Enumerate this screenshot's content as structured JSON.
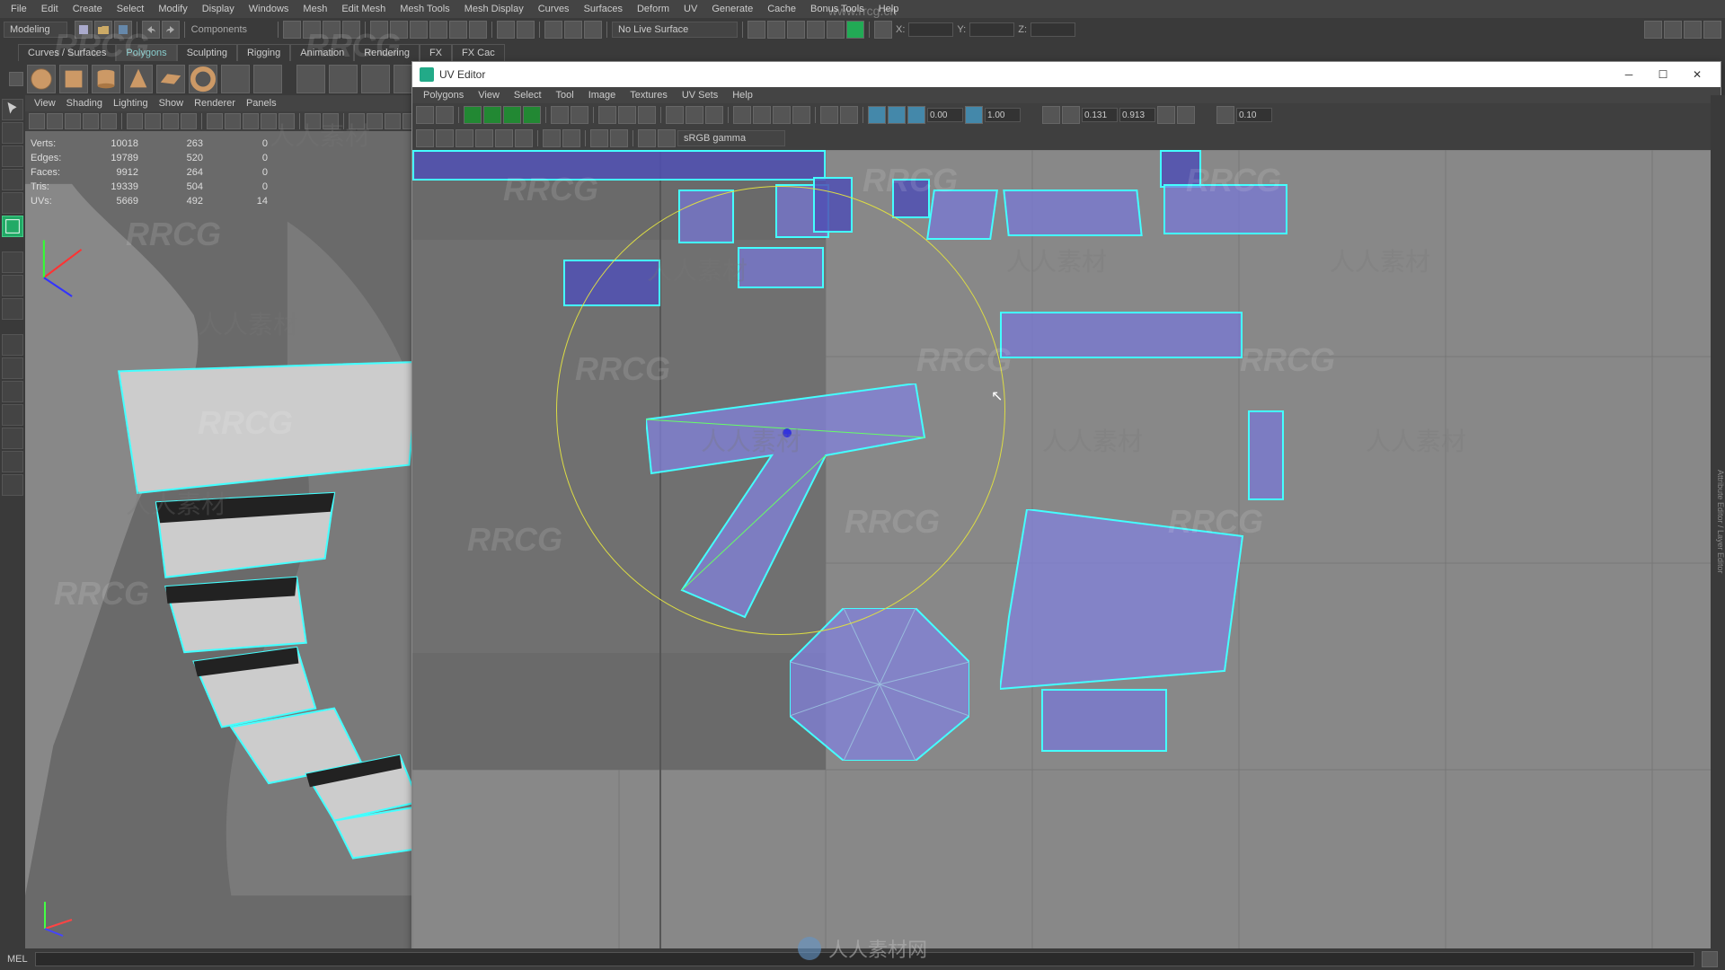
{
  "main_menu": [
    "File",
    "Edit",
    "Create",
    "Select",
    "Modify",
    "Display",
    "Windows",
    "Mesh",
    "Edit Mesh",
    "Mesh Tools",
    "Mesh Display",
    "Curves",
    "Surfaces",
    "Deform",
    "UV",
    "Generate",
    "Cache",
    "Bonus Tools",
    "Help"
  ],
  "mode_dropdown": "Modeling",
  "components_label": "Components",
  "no_live_surface": "No Live Surface",
  "xyz": {
    "x_label": "X:",
    "y_label": "Y:",
    "z_label": "Z:"
  },
  "shelf_tabs": [
    "Curves / Surfaces",
    "Polygons",
    "Sculpting",
    "Rigging",
    "Animation",
    "Rendering",
    "FX",
    "FX Cac"
  ],
  "active_shelf_tab": 1,
  "viewport_menu": [
    "View",
    "Shading",
    "Lighting",
    "Show",
    "Renderer",
    "Panels"
  ],
  "hud": {
    "rows": [
      {
        "label": "Verts:",
        "a": "10018",
        "b": "263",
        "c": "0"
      },
      {
        "label": "Edges:",
        "a": "19789",
        "b": "520",
        "c": "0"
      },
      {
        "label": "Faces:",
        "a": "9912",
        "b": "264",
        "c": "0"
      },
      {
        "label": "Tris:",
        "a": "19339",
        "b": "504",
        "c": "0"
      },
      {
        "label": "UVs:",
        "a": "5669",
        "b": "492",
        "c": "14"
      }
    ]
  },
  "uv_window": {
    "title": "UV Editor",
    "menu": [
      "Polygons",
      "View",
      "Select",
      "Tool",
      "Image",
      "Textures",
      "UV Sets",
      "Help"
    ],
    "val_a": "0.00",
    "val_b": "1.00",
    "val_c": "0.131",
    "val_d": "0.913",
    "val_e": "0.10",
    "gamma": "sRGB gamma"
  },
  "status": {
    "mel": "MEL"
  },
  "watermarks": {
    "url": "www.rrcg.cn",
    "rr": "RRCG",
    "cn": "人人素材",
    "bottom": "人人素材网"
  }
}
